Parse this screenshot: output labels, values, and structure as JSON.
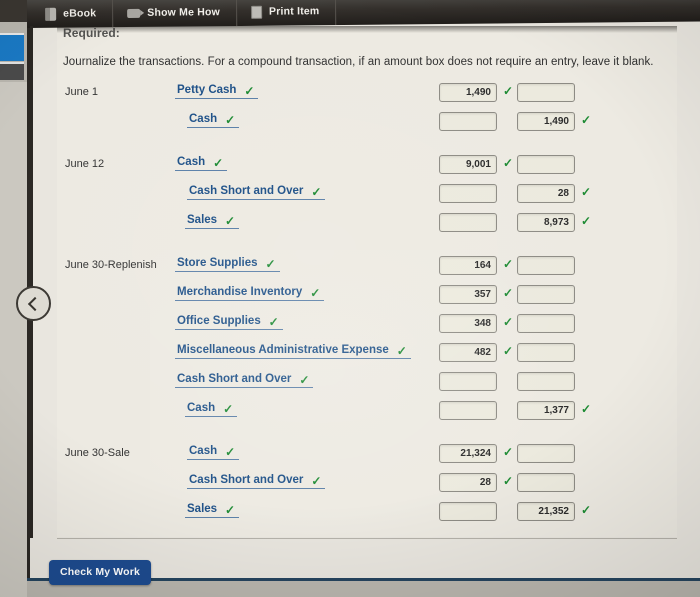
{
  "toolbar": {
    "items": [
      {
        "label": "eBook",
        "icon": "book-icon"
      },
      {
        "label": "Show Me How",
        "icon": "video-icon"
      },
      {
        "label": "Print Item",
        "icon": "page-icon"
      }
    ]
  },
  "content": {
    "required_heading": "Required:",
    "instructions": "Journalize the transactions. For a compound transaction, if an amount box does not require an entry, leave it blank.",
    "check_mark": "✓"
  },
  "footer": {
    "check_my_work_label": "Check My Work"
  },
  "sidebar": {
    "collapse_icon": "chevron-left-icon"
  },
  "colors": {
    "account_link": "#1c4f87",
    "check_mark": "#1c8a32",
    "primary_button": "#1d4b8f",
    "toolbar_bg": "#332f2b"
  },
  "journal": {
    "entries": [
      {
        "date": "June 1",
        "lines": [
          {
            "account": "Petty Cash",
            "indent": "debit",
            "debit": "1,490",
            "credit": "",
            "account_ok": true,
            "debit_ok": true,
            "credit_ok": false
          },
          {
            "account": "Cash",
            "indent": "credit",
            "debit": "",
            "credit": "1,490",
            "account_ok": true,
            "debit_ok": false,
            "credit_ok": true
          }
        ]
      },
      {
        "date": "June 12",
        "lines": [
          {
            "account": "Cash",
            "indent": "debit",
            "debit": "9,001",
            "credit": "",
            "account_ok": true,
            "debit_ok": true,
            "credit_ok": false
          },
          {
            "account": "Cash Short and Over",
            "indent": "credit",
            "debit": "",
            "credit": "28",
            "account_ok": true,
            "debit_ok": false,
            "credit_ok": true
          },
          {
            "account": "Sales",
            "indent": "credit2",
            "debit": "",
            "credit": "8,973",
            "account_ok": true,
            "debit_ok": false,
            "credit_ok": true
          }
        ]
      },
      {
        "date": "June 30-Replenish",
        "lines": [
          {
            "account": "Store Supplies",
            "indent": "debit",
            "debit": "164",
            "credit": "",
            "account_ok": true,
            "debit_ok": true,
            "credit_ok": false
          },
          {
            "account": "Merchandise Inventory",
            "indent": "debit",
            "debit": "357",
            "credit": "",
            "account_ok": true,
            "debit_ok": true,
            "credit_ok": false
          },
          {
            "account": "Office Supplies",
            "indent": "debit",
            "debit": "348",
            "credit": "",
            "account_ok": true,
            "debit_ok": true,
            "credit_ok": false
          },
          {
            "account": "Miscellaneous Administrative Expense",
            "indent": "debit",
            "debit": "482",
            "credit": "",
            "account_ok": true,
            "debit_ok": true,
            "credit_ok": false
          },
          {
            "account": "Cash Short and Over",
            "indent": "debit",
            "debit": "",
            "credit": "",
            "account_ok": true,
            "debit_ok": false,
            "credit_ok": false
          },
          {
            "account": "Cash",
            "indent": "credit2",
            "debit": "",
            "credit": "1,377",
            "account_ok": true,
            "debit_ok": false,
            "credit_ok": true
          }
        ]
      },
      {
        "date": "June 30-Sale",
        "lines": [
          {
            "account": "Cash",
            "indent": "credit",
            "debit": "21,324",
            "credit": "",
            "account_ok": true,
            "debit_ok": true,
            "credit_ok": false
          },
          {
            "account": "Cash Short and Over",
            "indent": "credit",
            "debit": "28",
            "credit": "",
            "account_ok": true,
            "debit_ok": true,
            "credit_ok": false
          },
          {
            "account": "Sales",
            "indent": "credit2",
            "debit": "",
            "credit": "21,352",
            "account_ok": true,
            "debit_ok": false,
            "credit_ok": true
          }
        ]
      }
    ]
  }
}
